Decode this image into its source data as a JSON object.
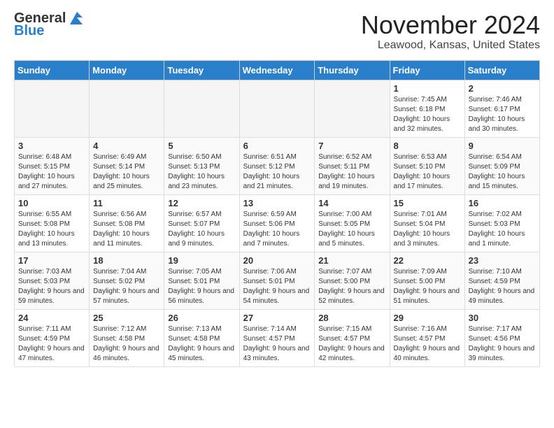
{
  "header": {
    "logo_line1": "General",
    "logo_line2": "Blue",
    "month_title": "November 2024",
    "location": "Leawood, Kansas, United States"
  },
  "weekdays": [
    "Sunday",
    "Monday",
    "Tuesday",
    "Wednesday",
    "Thursday",
    "Friday",
    "Saturday"
  ],
  "weeks": [
    [
      {
        "day": "",
        "empty": true
      },
      {
        "day": "",
        "empty": true
      },
      {
        "day": "",
        "empty": true
      },
      {
        "day": "",
        "empty": true
      },
      {
        "day": "",
        "empty": true
      },
      {
        "day": "1",
        "sunrise": "7:45 AM",
        "sunset": "6:18 PM",
        "daylight": "10 hours and 32 minutes."
      },
      {
        "day": "2",
        "sunrise": "7:46 AM",
        "sunset": "6:17 PM",
        "daylight": "10 hours and 30 minutes."
      }
    ],
    [
      {
        "day": "3",
        "sunrise": "6:48 AM",
        "sunset": "5:15 PM",
        "daylight": "10 hours and 27 minutes."
      },
      {
        "day": "4",
        "sunrise": "6:49 AM",
        "sunset": "5:14 PM",
        "daylight": "10 hours and 25 minutes."
      },
      {
        "day": "5",
        "sunrise": "6:50 AM",
        "sunset": "5:13 PM",
        "daylight": "10 hours and 23 minutes."
      },
      {
        "day": "6",
        "sunrise": "6:51 AM",
        "sunset": "5:12 PM",
        "daylight": "10 hours and 21 minutes."
      },
      {
        "day": "7",
        "sunrise": "6:52 AM",
        "sunset": "5:11 PM",
        "daylight": "10 hours and 19 minutes."
      },
      {
        "day": "8",
        "sunrise": "6:53 AM",
        "sunset": "5:10 PM",
        "daylight": "10 hours and 17 minutes."
      },
      {
        "day": "9",
        "sunrise": "6:54 AM",
        "sunset": "5:09 PM",
        "daylight": "10 hours and 15 minutes."
      }
    ],
    [
      {
        "day": "10",
        "sunrise": "6:55 AM",
        "sunset": "5:08 PM",
        "daylight": "10 hours and 13 minutes."
      },
      {
        "day": "11",
        "sunrise": "6:56 AM",
        "sunset": "5:08 PM",
        "daylight": "10 hours and 11 minutes."
      },
      {
        "day": "12",
        "sunrise": "6:57 AM",
        "sunset": "5:07 PM",
        "daylight": "10 hours and 9 minutes."
      },
      {
        "day": "13",
        "sunrise": "6:59 AM",
        "sunset": "5:06 PM",
        "daylight": "10 hours and 7 minutes."
      },
      {
        "day": "14",
        "sunrise": "7:00 AM",
        "sunset": "5:05 PM",
        "daylight": "10 hours and 5 minutes."
      },
      {
        "day": "15",
        "sunrise": "7:01 AM",
        "sunset": "5:04 PM",
        "daylight": "10 hours and 3 minutes."
      },
      {
        "day": "16",
        "sunrise": "7:02 AM",
        "sunset": "5:03 PM",
        "daylight": "10 hours and 1 minute."
      }
    ],
    [
      {
        "day": "17",
        "sunrise": "7:03 AM",
        "sunset": "5:03 PM",
        "daylight": "9 hours and 59 minutes."
      },
      {
        "day": "18",
        "sunrise": "7:04 AM",
        "sunset": "5:02 PM",
        "daylight": "9 hours and 57 minutes."
      },
      {
        "day": "19",
        "sunrise": "7:05 AM",
        "sunset": "5:01 PM",
        "daylight": "9 hours and 56 minutes."
      },
      {
        "day": "20",
        "sunrise": "7:06 AM",
        "sunset": "5:01 PM",
        "daylight": "9 hours and 54 minutes."
      },
      {
        "day": "21",
        "sunrise": "7:07 AM",
        "sunset": "5:00 PM",
        "daylight": "9 hours and 52 minutes."
      },
      {
        "day": "22",
        "sunrise": "7:09 AM",
        "sunset": "5:00 PM",
        "daylight": "9 hours and 51 minutes."
      },
      {
        "day": "23",
        "sunrise": "7:10 AM",
        "sunset": "4:59 PM",
        "daylight": "9 hours and 49 minutes."
      }
    ],
    [
      {
        "day": "24",
        "sunrise": "7:11 AM",
        "sunset": "4:59 PM",
        "daylight": "9 hours and 47 minutes."
      },
      {
        "day": "25",
        "sunrise": "7:12 AM",
        "sunset": "4:58 PM",
        "daylight": "9 hours and 46 minutes."
      },
      {
        "day": "26",
        "sunrise": "7:13 AM",
        "sunset": "4:58 PM",
        "daylight": "9 hours and 45 minutes."
      },
      {
        "day": "27",
        "sunrise": "7:14 AM",
        "sunset": "4:57 PM",
        "daylight": "9 hours and 43 minutes."
      },
      {
        "day": "28",
        "sunrise": "7:15 AM",
        "sunset": "4:57 PM",
        "daylight": "9 hours and 42 minutes."
      },
      {
        "day": "29",
        "sunrise": "7:16 AM",
        "sunset": "4:57 PM",
        "daylight": "9 hours and 40 minutes."
      },
      {
        "day": "30",
        "sunrise": "7:17 AM",
        "sunset": "4:56 PM",
        "daylight": "9 hours and 39 minutes."
      }
    ]
  ]
}
